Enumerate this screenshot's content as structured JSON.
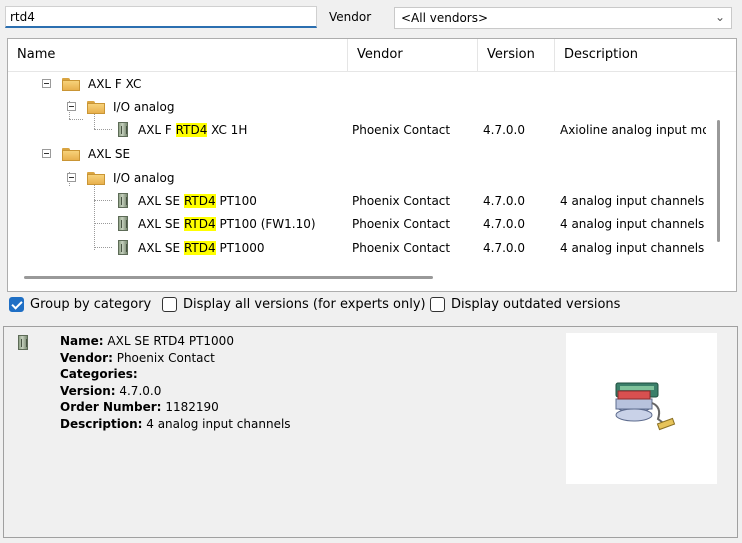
{
  "search": {
    "value": "rtd4"
  },
  "vendor": {
    "label": "Vendor",
    "selected": "<All vendors>"
  },
  "columns": {
    "name": "Name",
    "vendor": "Vendor",
    "version": "Version",
    "description": "Description"
  },
  "tree": {
    "group1": {
      "label": "AXL F XC",
      "sub": {
        "label": "I/O analog"
      },
      "item": {
        "pre": "AXL F ",
        "hl": "RTD4",
        "post": " XC 1H",
        "vendor": "Phoenix Contact",
        "version": "4.7.0.0",
        "description": "Axioline analog input mod"
      }
    },
    "group2": {
      "label": "AXL SE",
      "sub": {
        "label": "I/O analog"
      },
      "items": [
        {
          "pre": "AXL SE ",
          "hl": "RTD4",
          "post": " PT100",
          "vendor": "Phoenix Contact",
          "version": "4.7.0.0",
          "description": "4 analog input channels"
        },
        {
          "pre": "AXL SE ",
          "hl": "RTD4",
          "post": " PT100 (FW1.10)",
          "vendor": "Phoenix Contact",
          "version": "4.7.0.0",
          "description": "4 analog input channels"
        },
        {
          "pre": "AXL SE ",
          "hl": "RTD4",
          "post": " PT1000",
          "vendor": "Phoenix Contact",
          "version": "4.7.0.0",
          "description": "4 analog input channels"
        }
      ]
    }
  },
  "options": {
    "group_by_category": {
      "label": "Group by category",
      "checked": true
    },
    "all_versions": {
      "label": "Display all versions (for experts only)",
      "checked": false
    },
    "outdated": {
      "label": "Display outdated versions",
      "checked": false
    }
  },
  "details": {
    "name_label": "Name:",
    "name": "AXL SE RTD4 PT1000",
    "vendor_label": "Vendor:",
    "vendor": "Phoenix Contact",
    "categories_label": "Categories:",
    "version_label": "Version:",
    "version": "4.7.0.0",
    "order_label": "Order Number:",
    "order": "1182190",
    "description_label": "Description:",
    "description": "4 analog input channels"
  },
  "icons": {
    "folder": "folder-icon",
    "module": "module-icon",
    "device": "device-image-icon",
    "dropdown": "chevron-down-icon"
  },
  "colors": {
    "highlight": "#ffff00",
    "accent": "#1f6fc5"
  }
}
